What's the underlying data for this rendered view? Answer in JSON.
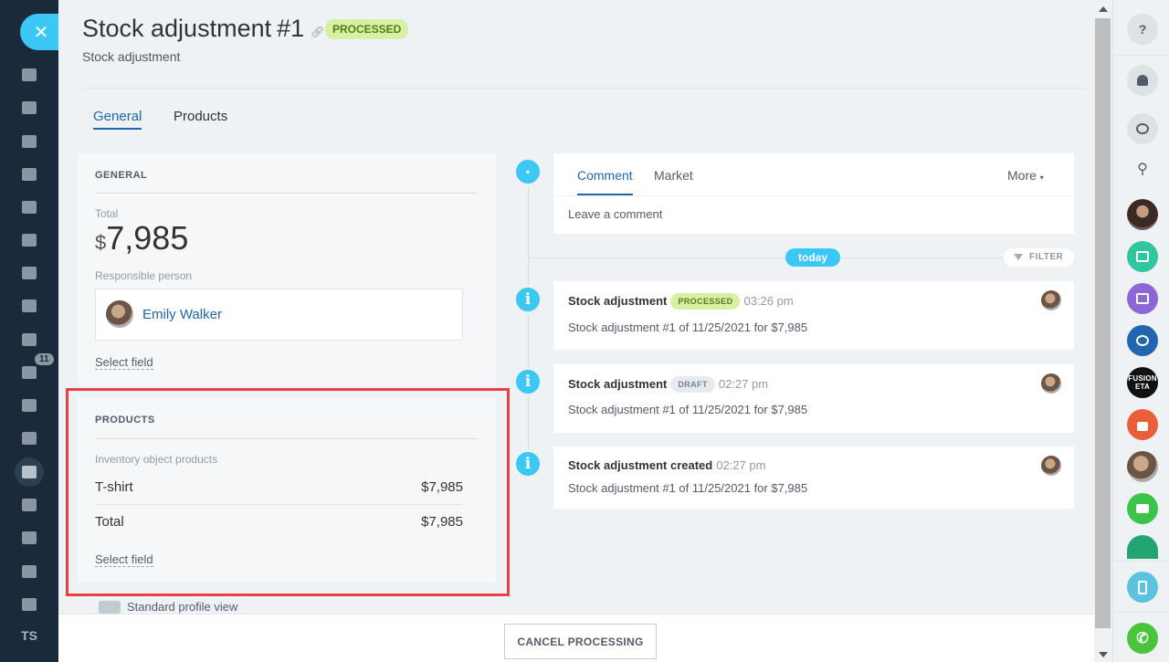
{
  "header": {
    "title": "Stock adjustment",
    "number": "#1",
    "status": "PROCESSED",
    "subtitle": "Stock adjustment"
  },
  "tabs": [
    {
      "label": "General",
      "active": true
    },
    {
      "label": "Products",
      "active": false
    }
  ],
  "general": {
    "title": "GENERAL",
    "total_label": "Total",
    "currency": "$",
    "total_value": "7,985",
    "responsible_label": "Responsible person",
    "responsible_name": "Emily Walker",
    "select_field": "Select field"
  },
  "products": {
    "title": "PRODUCTS",
    "label": "Inventory object products",
    "rows": [
      {
        "name": "T-shirt",
        "value": "$7,985"
      },
      {
        "name": "Total",
        "value": "$7,985"
      }
    ],
    "select_field": "Select field"
  },
  "standard_view": "Standard profile view",
  "comment": {
    "tabs": [
      "Comment",
      "Market"
    ],
    "more": "More",
    "placeholder": "Leave a comment"
  },
  "timeline": {
    "today": "today",
    "filter": "FILTER",
    "events": [
      {
        "title": "Stock adjustment",
        "badge": "PROCESSED",
        "badge_color": "green",
        "time": "03:26 pm",
        "text": "Stock adjustment #1 of 11/25/2021 for $7,985"
      },
      {
        "title": "Stock adjustment",
        "badge": "DRAFT",
        "badge_color": "grey",
        "time": "02:27 pm",
        "text": "Stock adjustment #1 of 11/25/2021 for $7,985"
      },
      {
        "title": "Stock adjustment created",
        "badge": "",
        "badge_color": "",
        "time": "02:27 pm",
        "text": "Stock adjustment #1 of 11/25/2021 for $7,985"
      }
    ]
  },
  "footer": {
    "cancel_button": "CANCEL PROCESSING"
  },
  "leftnav": {
    "close": "✕",
    "badge_count": "11",
    "user_initials": "TS"
  },
  "rightbar": {
    "help": "?",
    "search": "⚲",
    "fusion_text": "FUSION\nETA"
  },
  "colors": {
    "accent": "#3bc8f5",
    "link": "#2067b0",
    "highlight": "#e74040",
    "nav_bg": "#1a2a3a",
    "badge_green": "#d6f0a4"
  }
}
